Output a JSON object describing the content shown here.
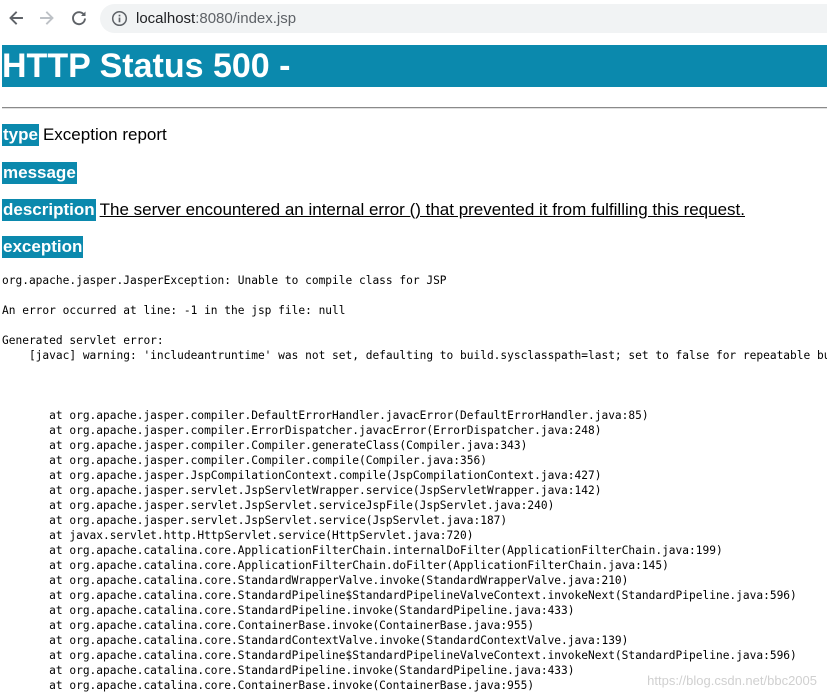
{
  "browser": {
    "url_host": "localhost",
    "url_rest": ":8080/index.jsp"
  },
  "page": {
    "title": "HTTP Status 500 -",
    "type_label": "type",
    "type_value": "Exception report",
    "message_label": "message",
    "description_label": "description",
    "description_value": "The server encountered an internal error () that prevented it from fulfilling this request.",
    "exception_label": "exception",
    "exception_line": "org.apache.jasper.JasperException: Unable to compile class for JSP",
    "error_line": "An error occurred at line: -1 in the jsp file: null",
    "generated_line1": "Generated servlet error:",
    "generated_line2": "    [javac] warning: 'includeantruntime' was not set, defaulting to build.sysclasspath=last; set to false for repeatable builds",
    "trace": [
      "\tat org.apache.jasper.compiler.DefaultErrorHandler.javacError(DefaultErrorHandler.java:85)",
      "\tat org.apache.jasper.compiler.ErrorDispatcher.javacError(ErrorDispatcher.java:248)",
      "\tat org.apache.jasper.compiler.Compiler.generateClass(Compiler.java:343)",
      "\tat org.apache.jasper.compiler.Compiler.compile(Compiler.java:356)",
      "\tat org.apache.jasper.JspCompilationContext.compile(JspCompilationContext.java:427)",
      "\tat org.apache.jasper.servlet.JspServletWrapper.service(JspServletWrapper.java:142)",
      "\tat org.apache.jasper.servlet.JspServlet.serviceJspFile(JspServlet.java:240)",
      "\tat org.apache.jasper.servlet.JspServlet.service(JspServlet.java:187)",
      "\tat javax.servlet.http.HttpServlet.service(HttpServlet.java:720)",
      "\tat org.apache.catalina.core.ApplicationFilterChain.internalDoFilter(ApplicationFilterChain.java:199)",
      "\tat org.apache.catalina.core.ApplicationFilterChain.doFilter(ApplicationFilterChain.java:145)",
      "\tat org.apache.catalina.core.StandardWrapperValve.invoke(StandardWrapperValve.java:210)",
      "\tat org.apache.catalina.core.StandardPipeline$StandardPipelineValveContext.invokeNext(StandardPipeline.java:596)",
      "\tat org.apache.catalina.core.StandardPipeline.invoke(StandardPipeline.java:433)",
      "\tat org.apache.catalina.core.ContainerBase.invoke(ContainerBase.java:955)",
      "\tat org.apache.catalina.core.StandardContextValve.invoke(StandardContextValve.java:139)",
      "\tat org.apache.catalina.core.StandardPipeline$StandardPipelineValveContext.invokeNext(StandardPipeline.java:596)",
      "\tat org.apache.catalina.core.StandardPipeline.invoke(StandardPipeline.java:433)",
      "\tat org.apache.catalina.core.ContainerBase.invoke(ContainerBase.java:955)"
    ],
    "watermark": "https://blog.csdn.net/bbc2005"
  },
  "colors": {
    "header_bg": "#0b89ad",
    "header_text": "#ffffff"
  },
  "icons": {
    "back": "arrow-left-icon",
    "forward": "arrow-right-icon",
    "reload": "reload-icon",
    "site_info": "info-icon"
  }
}
